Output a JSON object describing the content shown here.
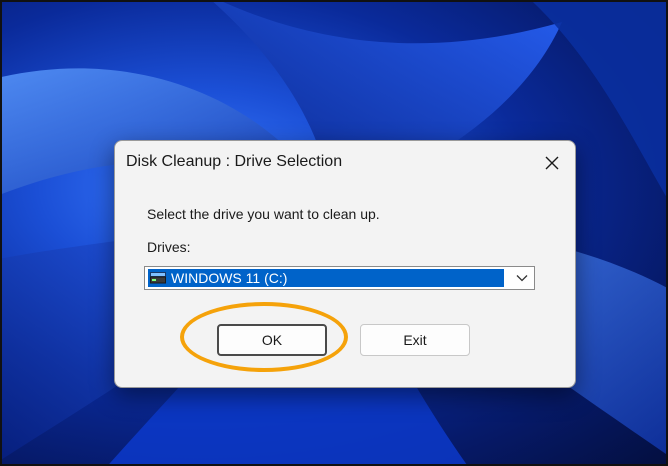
{
  "dialog": {
    "title": "Disk Cleanup : Drive Selection",
    "prompt": "Select the drive you want to clean up.",
    "drives_label": "Drives:",
    "selected_drive": "WINDOWS 11 (C:)",
    "ok_label": "OK",
    "exit_label": "Exit"
  },
  "icons": {
    "close": "close-icon",
    "drive": "drive-icon",
    "dropdown": "chevron-down-icon"
  },
  "colors": {
    "selection": "#0063c9",
    "highlight_ring": "#f5a20a",
    "wallpaper": "#1b4fd6"
  }
}
